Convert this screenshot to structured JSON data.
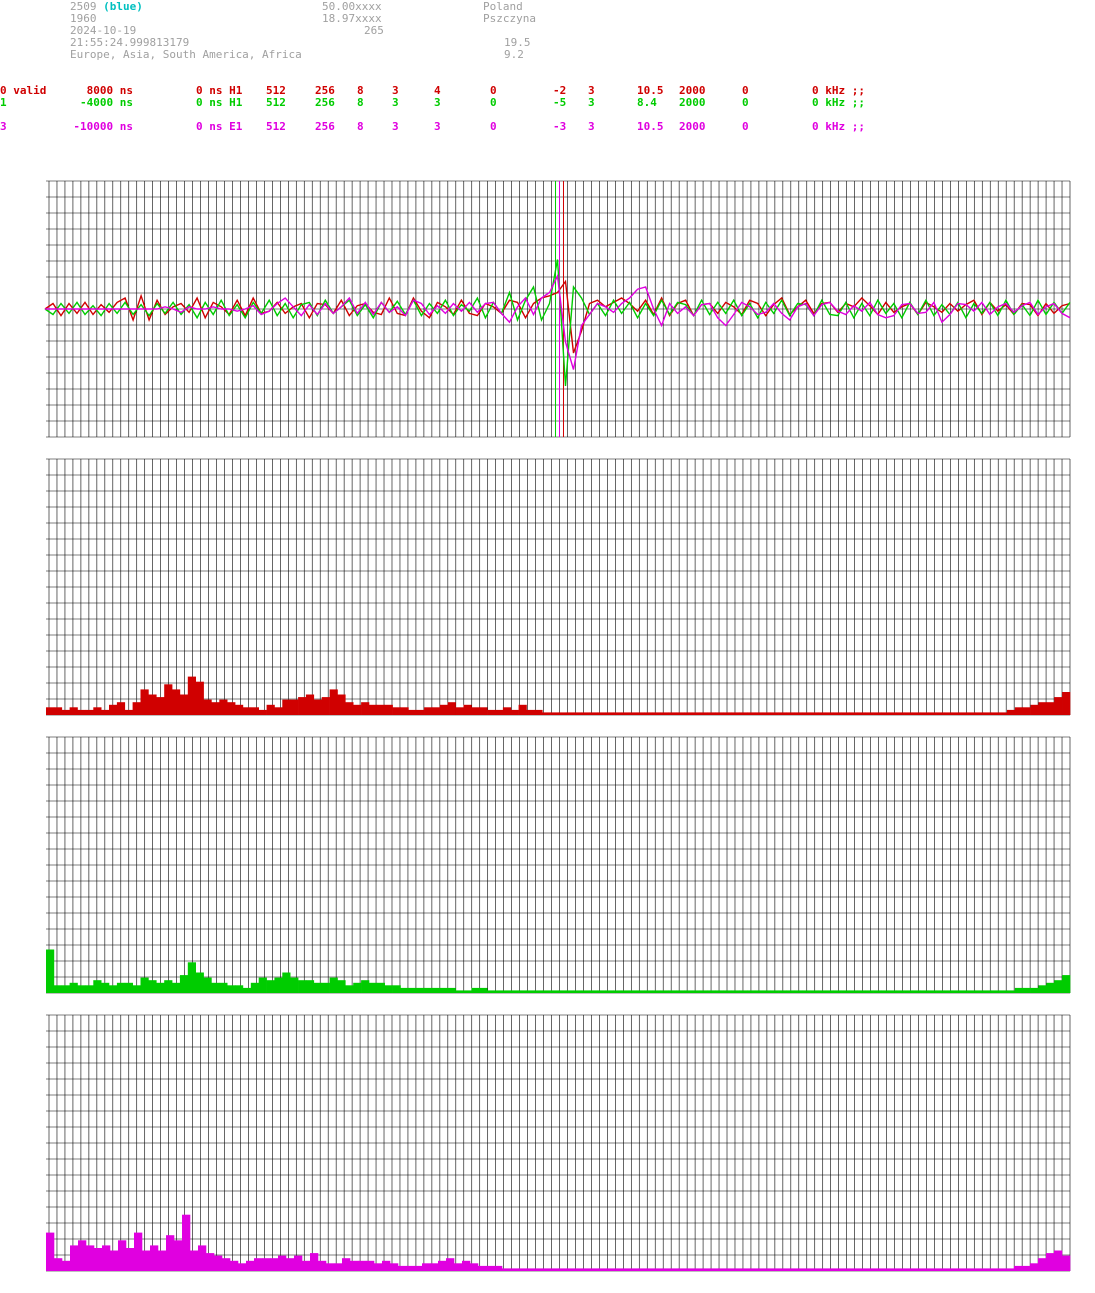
{
  "header": {
    "station_id": "2509",
    "station_color_label": "(blue)",
    "num": "1960",
    "date": "2024-10-19",
    "time": "21:55:24.999813179",
    "regions": "Europe, Asia, South America, Africa",
    "lat": "50.00xxxx",
    "lon": "18.97xxxx",
    "alt": "265",
    "country": "Poland",
    "city": "Pszczyna",
    "val1": "19.5",
    "val2": "9.2"
  },
  "channels": [
    {
      "cols": [
        "0 valid",
        "8000 ns",
        "0 ns H1",
        "512",
        "256",
        "8",
        "3",
        "4",
        "0",
        "-2",
        "3",
        "10.5",
        "2000",
        "0",
        "0 kHz ;;"
      ],
      "color": "#d00000"
    },
    {
      "cols": [
        "1",
        "-4000 ns",
        "0 ns H1",
        "512",
        "256",
        "8",
        "3",
        "3",
        "0",
        "-5",
        "3",
        "8.4",
        "2000",
        "0",
        "0 kHz ;;"
      ],
      "color": "#00cc00"
    },
    {
      "cols": [
        "3",
        "-10000 ns",
        "0 ns E1",
        "512",
        "256",
        "8",
        "3",
        "3",
        "0",
        "-3",
        "3",
        "10.5",
        "2000",
        "0",
        "0 kHz ;;"
      ],
      "color": "#e000e0"
    }
  ],
  "chart_data": [
    {
      "type": "line",
      "grid": true,
      "ylim": [
        -1,
        1
      ],
      "x": [
        0,
        128
      ],
      "markers": [
        63.5,
        64.0,
        64.5
      ],
      "series": [
        {
          "color": "#d00000",
          "values": [
            0.0,
            0.05,
            -0.06,
            0.05,
            -0.04,
            0.06,
            -0.05,
            0.04,
            -0.03,
            0.06,
            0.1,
            -0.1,
            0.12,
            -0.1,
            0.08,
            -0.05,
            0.02,
            0.05,
            -0.03,
            0.1,
            -0.08,
            0.06,
            0.02,
            -0.05,
            0.08,
            -0.06,
            0.1,
            -0.04,
            -0.02,
            0.06,
            -0.04,
            0.02,
            0.05,
            -0.08,
            0.05,
            0.04,
            -0.04,
            0.08,
            -0.06,
            0.03,
            0.05,
            -0.03,
            -0.05,
            0.1,
            -0.04,
            -0.06,
            0.1,
            -0.02,
            -0.08,
            0.06,
            0.02,
            -0.05,
            0.08,
            -0.04,
            -0.06,
            0.05,
            0.02,
            -0.04,
            0.08,
            0.06,
            -0.08,
            0.05,
            0.1,
            0.12,
            0.15,
            0.25,
            -0.4,
            -0.2,
            0.05,
            0.08,
            0.02,
            0.06,
            0.1,
            0.05,
            -0.02,
            0.08,
            -0.05,
            0.1,
            -0.06,
            0.05,
            0.08,
            -0.06,
            0.04,
            0.05,
            -0.04,
            0.06,
            0.02,
            -0.05,
            0.08,
            0.05,
            -0.06,
            0.04,
            0.1,
            -0.05,
            0.02,
            0.08,
            -0.04,
            0.05,
            0.06,
            -0.03,
            0.05,
            0.02,
            0.1,
            0.03,
            -0.05,
            0.06,
            -0.03,
            0.02,
            0.05,
            -0.05,
            0.06,
            0.02,
            -0.03,
            0.05,
            -0.02,
            0.04,
            0.08,
            -0.05,
            0.06,
            -0.02,
            0.04,
            -0.05,
            0.05,
            0.04,
            -0.06,
            0.05,
            -0.04,
            0.03,
            0.05
          ]
        },
        {
          "color": "#00cc00",
          "values": [
            0.0,
            -0.05,
            0.05,
            -0.04,
            0.06,
            -0.05,
            0.03,
            -0.06,
            0.05,
            -0.04,
            0.06,
            -0.05,
            0.04,
            -0.06,
            0.05,
            -0.04,
            0.06,
            -0.05,
            0.04,
            -0.08,
            0.06,
            -0.05,
            0.08,
            -0.06,
            0.04,
            -0.08,
            0.06,
            -0.04,
            0.08,
            -0.06,
            0.05,
            -0.08,
            0.04,
            0.06,
            -0.06,
            0.08,
            -0.04,
            0.02,
            0.08,
            -0.06,
            0.04,
            -0.08,
            0.06,
            -0.03,
            0.07,
            -0.05,
            0.08,
            -0.06,
            0.05,
            -0.04,
            0.08,
            -0.06,
            0.04,
            -0.02,
            0.1,
            -0.08,
            0.06,
            -0.04,
            0.15,
            -0.1,
            0.08,
            0.2,
            -0.1,
            0.05,
            0.45,
            -0.7,
            0.2,
            0.1,
            -0.05,
            0.05,
            -0.06,
            0.08,
            -0.04,
            0.06,
            -0.08,
            0.05,
            -0.06,
            0.08,
            -0.05,
            0.06,
            0.04,
            -0.06,
            0.08,
            -0.05,
            0.06,
            -0.04,
            0.08,
            -0.06,
            0.05,
            -0.08,
            0.06,
            -0.04,
            0.08,
            -0.06,
            0.05,
            0.04,
            -0.06,
            0.08,
            -0.05,
            -0.06,
            0.06,
            -0.08,
            0.05,
            -0.06,
            0.08,
            -0.04,
            0.05,
            -0.08,
            0.06,
            -0.05,
            0.08,
            -0.06,
            0.04,
            -0.05,
            0.06,
            -0.08,
            0.05,
            -0.04,
            0.06,
            -0.06,
            0.08,
            -0.05,
            0.04,
            -0.06,
            0.08,
            -0.05,
            0.06,
            -0.04,
            0.06
          ]
        },
        {
          "color": "#e000e0",
          "values": [
            0.0,
            0.0,
            0.0,
            0.0,
            0.0,
            0.0,
            0.0,
            0.0,
            0.0,
            0.0,
            0.0,
            0.0,
            0.0,
            0.0,
            0.0,
            0.02,
            0.0,
            -0.03,
            0.02,
            0.0,
            0.0,
            0.02,
            0.0,
            0.0,
            -0.02,
            0.0,
            0.03,
            -0.05,
            -0.02,
            0.05,
            0.1,
            0.02,
            -0.06,
            0.04,
            -0.05,
            0.05,
            -0.04,
            0.02,
            0.1,
            -0.04,
            0.06,
            -0.05,
            0.06,
            -0.03,
            0.02,
            -0.06,
            0.08,
            0.05,
            -0.05,
            0.03,
            -0.04,
            0.05,
            -0.02,
            0.06,
            -0.03,
            0.05,
            0.06,
            -0.04,
            -0.12,
            0.02,
            0.1,
            -0.05,
            0.1,
            0.15,
            0.3,
            -0.3,
            -0.55,
            -0.15,
            -0.05,
            0.05,
            0.02,
            -0.03,
            0.05,
            0.1,
            0.18,
            0.2,
            0.0,
            -0.15,
            0.05,
            -0.04,
            0.02,
            -0.06,
            0.04,
            0.05,
            -0.08,
            -0.15,
            -0.05,
            0.06,
            0.02,
            -0.05,
            -0.03,
            0.05,
            -0.04,
            -0.1,
            0.02,
            0.05,
            -0.06,
            0.04,
            0.06,
            -0.02,
            -0.05,
            0.03,
            -0.02,
            0.06,
            -0.05,
            -0.08,
            -0.06,
            0.04,
            0.05,
            -0.04,
            -0.03,
            0.06,
            -0.12,
            -0.05,
            0.05,
            0.04,
            -0.02,
            0.06,
            -0.05,
            0.02,
            0.05,
            -0.03,
            0.03,
            0.06,
            -0.05,
            0.02,
            0.05,
            -0.04,
            -0.08
          ]
        }
      ]
    },
    {
      "type": "bar",
      "grid": true,
      "ylim": [
        0,
        1
      ],
      "color": "#d00000",
      "values": [
        0.03,
        0.03,
        0.02,
        0.03,
        0.02,
        0.02,
        0.03,
        0.02,
        0.04,
        0.05,
        0.02,
        0.05,
        0.1,
        0.08,
        0.07,
        0.12,
        0.1,
        0.08,
        0.15,
        0.13,
        0.06,
        0.05,
        0.06,
        0.05,
        0.04,
        0.03,
        0.03,
        0.02,
        0.04,
        0.03,
        0.06,
        0.06,
        0.07,
        0.08,
        0.06,
        0.07,
        0.1,
        0.08,
        0.05,
        0.04,
        0.05,
        0.04,
        0.04,
        0.04,
        0.03,
        0.03,
        0.02,
        0.02,
        0.03,
        0.03,
        0.04,
        0.05,
        0.03,
        0.04,
        0.03,
        0.03,
        0.02,
        0.02,
        0.03,
        0.02,
        0.04,
        0.02,
        0.02,
        0.01,
        0.01,
        0.01,
        0.01,
        0.01,
        0.01,
        0.01,
        0.01,
        0.01,
        0.01,
        0.01,
        0.01,
        0.01,
        0.01,
        0.01,
        0.01,
        0.01,
        0.01,
        0.01,
        0.01,
        0.01,
        0.01,
        0.01,
        0.01,
        0.01,
        0.01,
        0.01,
        0.01,
        0.01,
        0.01,
        0.01,
        0.01,
        0.01,
        0.01,
        0.01,
        0.01,
        0.01,
        0.01,
        0.01,
        0.01,
        0.01,
        0.01,
        0.01,
        0.01,
        0.01,
        0.01,
        0.01,
        0.01,
        0.01,
        0.01,
        0.01,
        0.01,
        0.01,
        0.01,
        0.01,
        0.01,
        0.01,
        0.01,
        0.01,
        0.02,
        0.03,
        0.03,
        0.04,
        0.05,
        0.05,
        0.07,
        0.09
      ]
    },
    {
      "type": "bar",
      "grid": true,
      "ylim": [
        0,
        1
      ],
      "color": "#00cc00",
      "values": [
        0.17,
        0.03,
        0.03,
        0.04,
        0.03,
        0.03,
        0.05,
        0.04,
        0.03,
        0.04,
        0.04,
        0.03,
        0.06,
        0.05,
        0.04,
        0.05,
        0.04,
        0.07,
        0.12,
        0.08,
        0.06,
        0.04,
        0.04,
        0.03,
        0.03,
        0.02,
        0.04,
        0.06,
        0.05,
        0.06,
        0.08,
        0.06,
        0.05,
        0.05,
        0.04,
        0.04,
        0.06,
        0.05,
        0.03,
        0.04,
        0.05,
        0.04,
        0.04,
        0.03,
        0.03,
        0.02,
        0.02,
        0.02,
        0.02,
        0.02,
        0.02,
        0.02,
        0.01,
        0.01,
        0.02,
        0.02,
        0.01,
        0.01,
        0.01,
        0.01,
        0.01,
        0.01,
        0.01,
        0.01,
        0.01,
        0.01,
        0.01,
        0.01,
        0.01,
        0.01,
        0.01,
        0.01,
        0.01,
        0.01,
        0.01,
        0.01,
        0.01,
        0.01,
        0.01,
        0.01,
        0.01,
        0.01,
        0.01,
        0.01,
        0.01,
        0.01,
        0.01,
        0.01,
        0.01,
        0.01,
        0.01,
        0.01,
        0.01,
        0.01,
        0.01,
        0.01,
        0.01,
        0.01,
        0.01,
        0.01,
        0.01,
        0.01,
        0.01,
        0.01,
        0.01,
        0.01,
        0.01,
        0.01,
        0.01,
        0.01,
        0.01,
        0.01,
        0.01,
        0.01,
        0.01,
        0.01,
        0.01,
        0.01,
        0.01,
        0.01,
        0.01,
        0.01,
        0.01,
        0.02,
        0.02,
        0.02,
        0.03,
        0.04,
        0.05,
        0.07
      ]
    },
    {
      "type": "bar",
      "grid": true,
      "ylim": [
        0,
        1
      ],
      "color": "#e000e0",
      "values": [
        0.15,
        0.05,
        0.04,
        0.1,
        0.12,
        0.1,
        0.09,
        0.1,
        0.08,
        0.12,
        0.09,
        0.15,
        0.08,
        0.1,
        0.08,
        0.14,
        0.12,
        0.22,
        0.08,
        0.1,
        0.07,
        0.06,
        0.05,
        0.04,
        0.03,
        0.04,
        0.05,
        0.05,
        0.05,
        0.06,
        0.05,
        0.06,
        0.04,
        0.07,
        0.04,
        0.03,
        0.03,
        0.05,
        0.04,
        0.04,
        0.04,
        0.03,
        0.04,
        0.03,
        0.02,
        0.02,
        0.02,
        0.03,
        0.03,
        0.04,
        0.05,
        0.03,
        0.04,
        0.03,
        0.02,
        0.02,
        0.02,
        0.01,
        0.01,
        0.01,
        0.01,
        0.01,
        0.01,
        0.01,
        0.01,
        0.01,
        0.01,
        0.01,
        0.01,
        0.01,
        0.01,
        0.01,
        0.01,
        0.01,
        0.01,
        0.01,
        0.01,
        0.01,
        0.01,
        0.01,
        0.01,
        0.01,
        0.01,
        0.01,
        0.01,
        0.01,
        0.01,
        0.01,
        0.01,
        0.01,
        0.01,
        0.01,
        0.01,
        0.01,
        0.01,
        0.01,
        0.01,
        0.01,
        0.01,
        0.01,
        0.01,
        0.01,
        0.01,
        0.01,
        0.01,
        0.01,
        0.01,
        0.01,
        0.01,
        0.01,
        0.01,
        0.01,
        0.01,
        0.01,
        0.01,
        0.01,
        0.01,
        0.01,
        0.01,
        0.01,
        0.01,
        0.02,
        0.02,
        0.03,
        0.05,
        0.07,
        0.08,
        0.06
      ]
    }
  ]
}
